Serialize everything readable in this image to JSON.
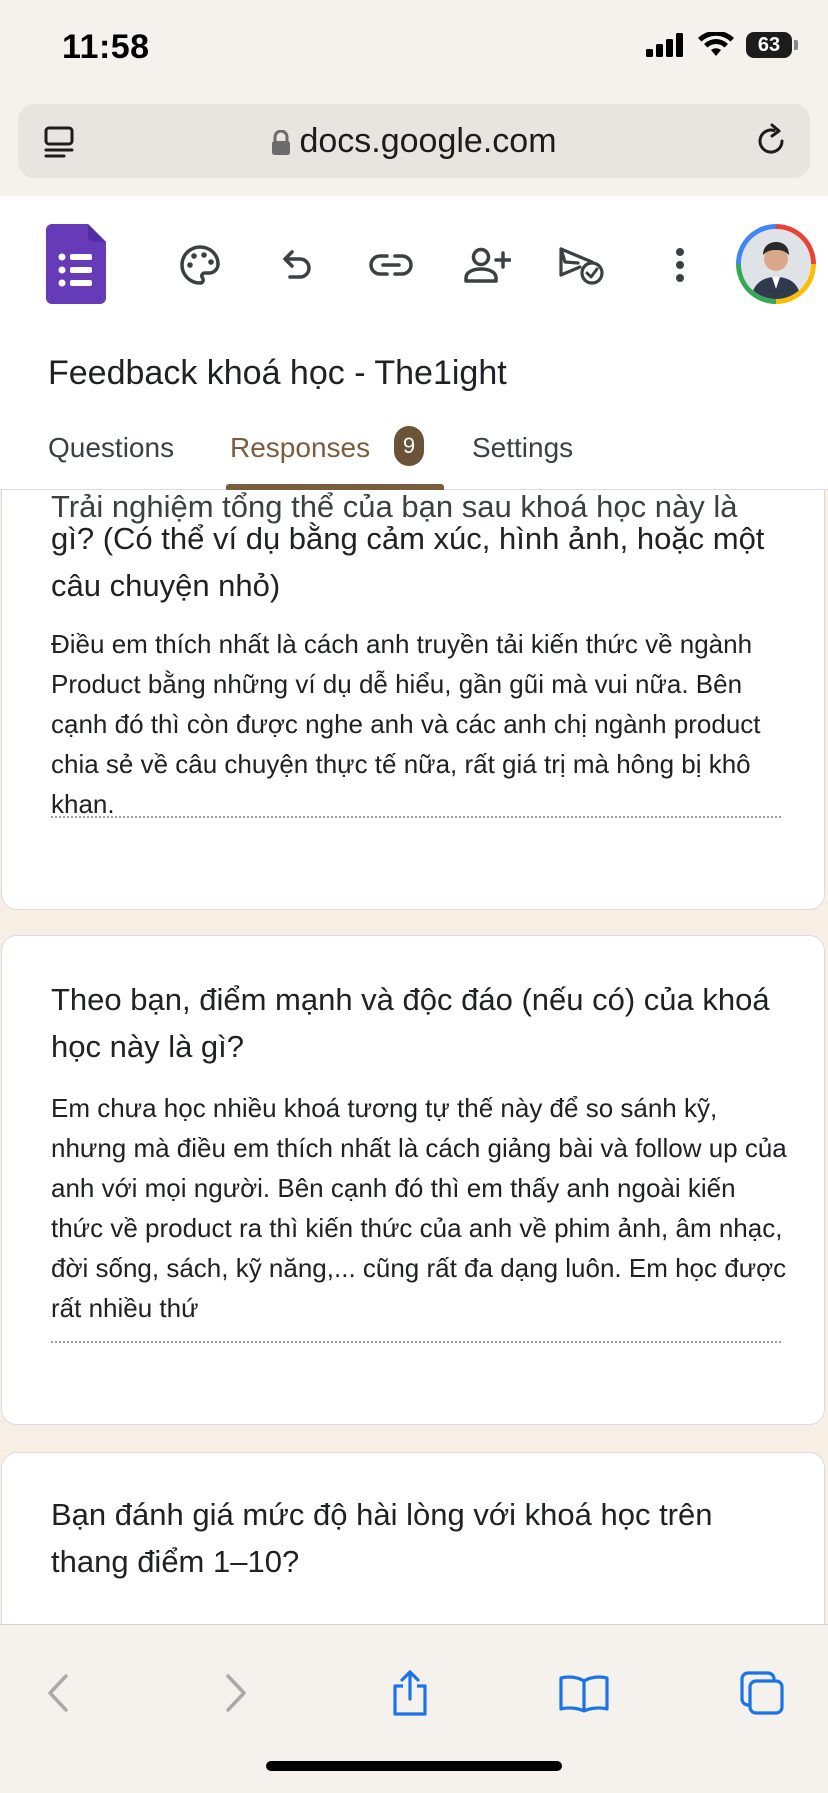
{
  "status": {
    "time": "11:58",
    "battery": "63"
  },
  "browser": {
    "url": "docs.google.com"
  },
  "app": {
    "title": "Feedback khoá học - The1ight",
    "tabs": {
      "questions": "Questions",
      "responses": "Responses",
      "responses_count": "9",
      "settings": "Settings"
    },
    "colors": {
      "accent": "#7b5c3c",
      "forms_purple": "#673ab7"
    }
  },
  "cards": [
    {
      "question_partial": "Trải nghiệm tổng thể của bạn sau khoá học này là",
      "question_line2": "gì? (Có thể ví dụ bằng cảm xúc, hình ảnh, hoặc một",
      "question_line3": "câu chuyện nhỏ)",
      "answer": "Điều em thích nhất là cách anh truyền tải kiến thức về ngành Product bằng những ví dụ dễ hiểu, gần gũi mà vui nữa. Bên cạnh đó thì còn được nghe anh và các anh chị ngành product chia sẻ về câu chuyện thực tế nữa, rất giá trị mà hông bị khô khan."
    },
    {
      "question": "Theo bạn, điểm mạnh và độc đáo (nếu có) của khoá học này là gì?",
      "answer": "Em chưa học nhiều khoá tương tự thế này để so sánh kỹ, nhưng mà điều em thích nhất là cách giảng bài và follow up của anh với mọi người. Bên cạnh đó thì em thấy anh ngoài kiến thức về product ra thì kiến thức của anh về phim ảnh, âm nhạc, đời sống, sách, kỹ năng,... cũng rất đa dạng luôn. Em học được rất nhiều thứ"
    },
    {
      "question": "Bạn đánh giá mức độ hài lòng với khoá học trên thang điểm 1–10?"
    }
  ],
  "icons": {
    "toolbar": [
      "palette-icon",
      "undo-icon",
      "link-icon",
      "add-person-icon",
      "send-icon",
      "more-vert-icon"
    ],
    "bottom": [
      "back-icon",
      "forward-icon",
      "share-icon",
      "bookmarks-icon",
      "tabs-icon"
    ]
  }
}
